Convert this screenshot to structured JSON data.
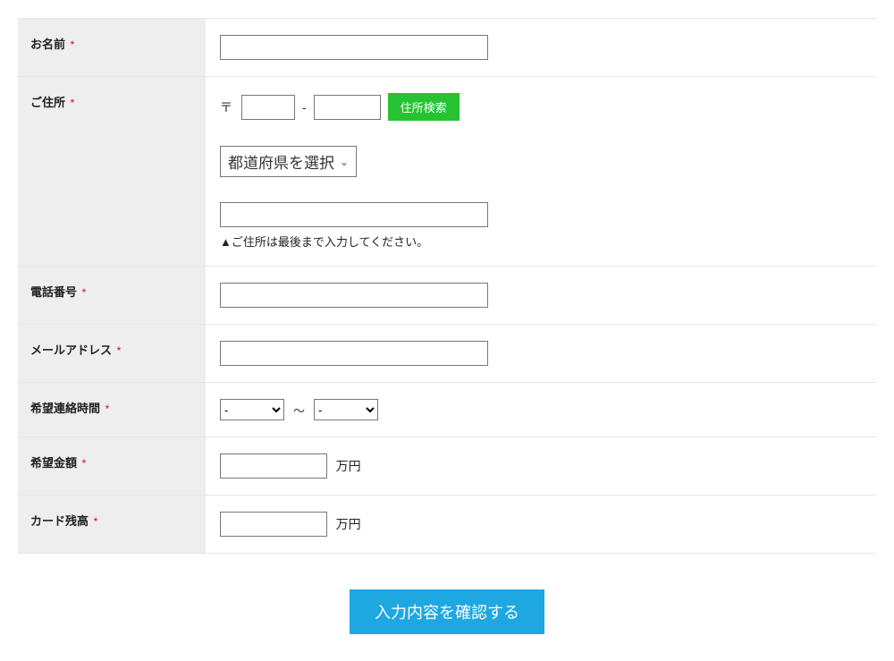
{
  "fields": {
    "name": {
      "label": "お名前"
    },
    "address": {
      "label": "ご住所",
      "zip_symbol": "〒",
      "zip_hyphen": "-",
      "search_button": "住所検索",
      "pref_placeholder": "都道府県を選択",
      "note": "▲ご住所は最後まで入力してください。"
    },
    "phone": {
      "label": "電話番号"
    },
    "email": {
      "label": "メールアドレス"
    },
    "contact_time": {
      "label": "希望連絡時間",
      "option_blank": "-",
      "range_separator": "～"
    },
    "amount": {
      "label": "希望金額",
      "unit": "万円"
    },
    "balance": {
      "label": "カード残高",
      "unit": "万円"
    }
  },
  "required_mark": "*",
  "submit_label": "入力内容を確認する"
}
